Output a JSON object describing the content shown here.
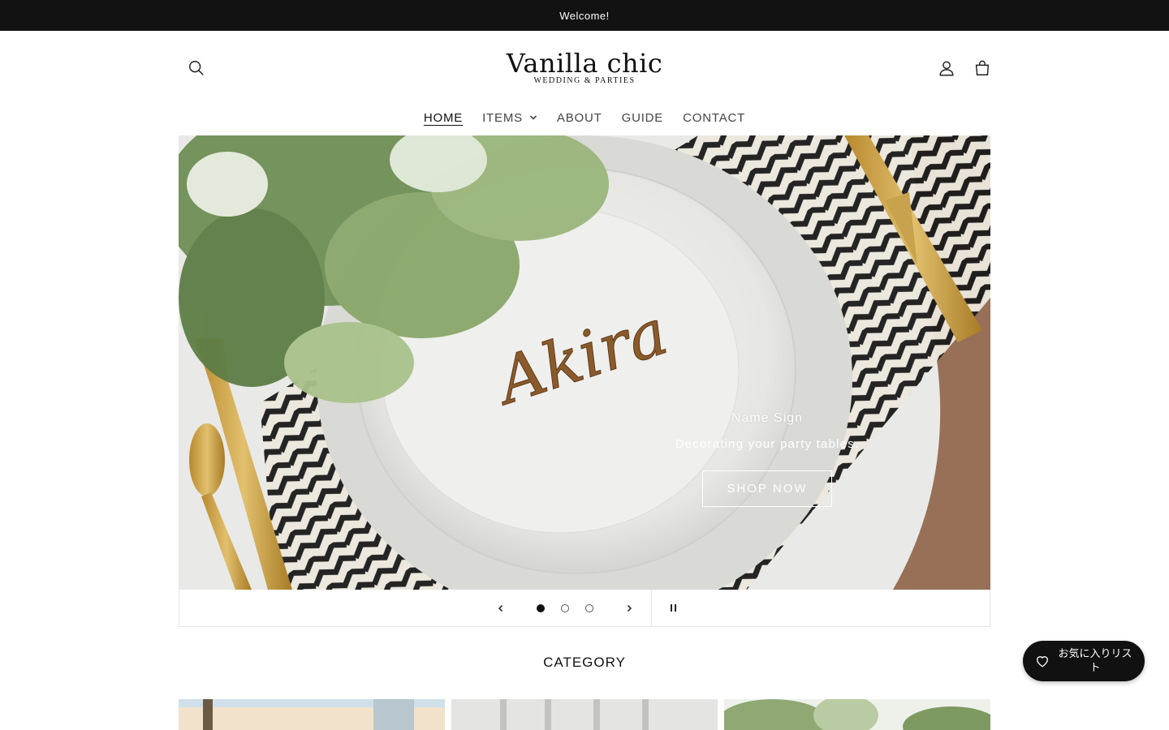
{
  "announcement": {
    "text": "Welcome!"
  },
  "header": {
    "logo_main": "Vanilla chic",
    "logo_sub": "WEDDING & PARTIES",
    "icons": {
      "search": "search-icon",
      "account": "user-icon",
      "cart": "bag-icon"
    }
  },
  "nav": {
    "items": [
      {
        "label": "HOME",
        "active": true
      },
      {
        "label": "ITEMS",
        "has_dropdown": true
      },
      {
        "label": "ABOUT"
      },
      {
        "label": "GUIDE"
      },
      {
        "label": "CONTACT"
      }
    ]
  },
  "hero": {
    "image_text": "Akira",
    "title": "Name Sign",
    "subtitle": "Decorating your party tables.",
    "button_label": "SHOP NOW"
  },
  "slider": {
    "slide_count": 3,
    "active_index": 0
  },
  "category": {
    "title": "CATEGORY"
  },
  "favorites": {
    "label": "お気に入りリスト",
    "icon": "heart-icon"
  },
  "colors": {
    "announcement_bg": "#121212",
    "fav_bg": "#111111",
    "text": "#222222"
  }
}
